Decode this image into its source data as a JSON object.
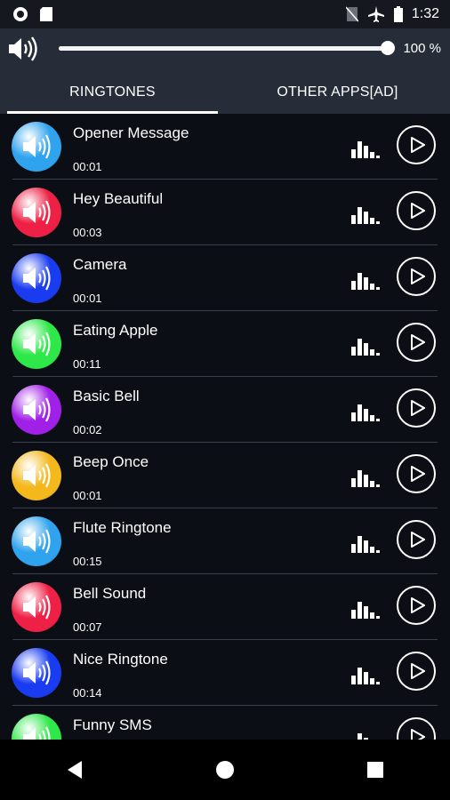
{
  "status_bar": {
    "time": "1:32",
    "icons": [
      "circle-icon",
      "sd-card-icon",
      "no-sim-icon",
      "airplane-icon",
      "battery-icon"
    ]
  },
  "volume": {
    "percent_label": "100 %",
    "level": 1.0
  },
  "tabs": [
    {
      "label": "RINGTONES",
      "active": true
    },
    {
      "label": "OTHER APPS[AD]",
      "active": false
    }
  ],
  "ringtones": [
    {
      "title": "Opener Message",
      "duration": "00:01",
      "color": "#2fa3ee"
    },
    {
      "title": "Hey Beautiful",
      "duration": "00:03",
      "color": "#ee2045"
    },
    {
      "title": "Camera",
      "duration": "00:01",
      "color": "#1a3cf0"
    },
    {
      "title": "Eating Apple",
      "duration": "00:11",
      "color": "#2ee84a"
    },
    {
      "title": "Basic Bell",
      "duration": "00:02",
      "color": "#a020e8"
    },
    {
      "title": "Beep Once",
      "duration": "00:01",
      "color": "#f4b81c"
    },
    {
      "title": "Flute Ringtone",
      "duration": "00:15",
      "color": "#2fa3ee"
    },
    {
      "title": "Bell Sound",
      "duration": "00:07",
      "color": "#ee2045"
    },
    {
      "title": "Nice Ringtone",
      "duration": "00:14",
      "color": "#1a3cf0"
    },
    {
      "title": "Funny SMS",
      "duration": "",
      "color": "#2ee84a"
    }
  ],
  "nav": [
    "back-icon",
    "home-icon",
    "recents-icon"
  ]
}
